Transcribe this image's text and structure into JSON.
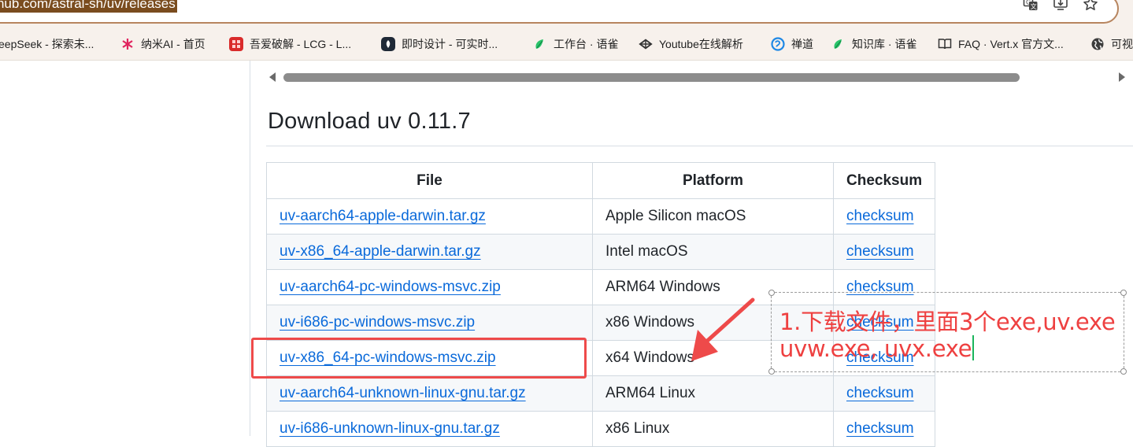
{
  "browser": {
    "url": "github.com/astral-sh/uv/releases",
    "bookmarks": [
      {
        "label": "eepSeek - 探索未...",
        "icon": "deepseek-icon"
      },
      {
        "label": "纳米AI - 首页",
        "icon": "nano-ai-icon"
      },
      {
        "label": "吾爱破解 - LCG - L...",
        "icon": "52pojie-icon"
      },
      {
        "label": "即时设计 - 可实时...",
        "icon": "jishi-design-icon"
      },
      {
        "label": "工作台 · 语雀",
        "icon": "yuque-icon"
      },
      {
        "label": "Youtube在线解析",
        "icon": "youtube-parse-icon"
      },
      {
        "label": "禅道",
        "icon": "zentao-icon"
      },
      {
        "label": "知识库 · 语雀",
        "icon": "yuque-icon"
      },
      {
        "label": "FAQ · Vert.x 官方文...",
        "icon": "book-icon"
      },
      {
        "label": "可视",
        "icon": "globe-icon"
      }
    ]
  },
  "release": {
    "heading": "Download uv 0.11.7",
    "columns": [
      "File",
      "Platform",
      "Checksum"
    ],
    "rows": [
      {
        "file": "uv-aarch64-apple-darwin.tar.gz",
        "platform": "Apple Silicon macOS",
        "checksum": "checksum"
      },
      {
        "file": "uv-x86_64-apple-darwin.tar.gz",
        "platform": "Intel macOS",
        "checksum": "checksum"
      },
      {
        "file": "uv-aarch64-pc-windows-msvc.zip",
        "platform": "ARM64 Windows",
        "checksum": "checksum"
      },
      {
        "file": "uv-i686-pc-windows-msvc.zip",
        "platform": "x86 Windows",
        "checksum": "checksum"
      },
      {
        "file": "uv-x86_64-pc-windows-msvc.zip",
        "platform": "x64 Windows",
        "checksum": "checksum"
      },
      {
        "file": "uv-aarch64-unknown-linux-gnu.tar.gz",
        "platform": "ARM64 Linux",
        "checksum": "checksum"
      },
      {
        "file": "uv-i686-unknown-linux-gnu.tar.gz",
        "platform": "x86 Linux",
        "checksum": "checksum"
      }
    ]
  },
  "annotation": {
    "line1": "1.下载文件，里面3个exe,uv.exe",
    "line2": "uvw.exe, uvx.exe"
  },
  "colors": {
    "link": "#0969da",
    "annotation_red": "#ee4a4a",
    "url_highlight": "#7a4c1e",
    "chrome_bg": "#f7f1ec"
  }
}
